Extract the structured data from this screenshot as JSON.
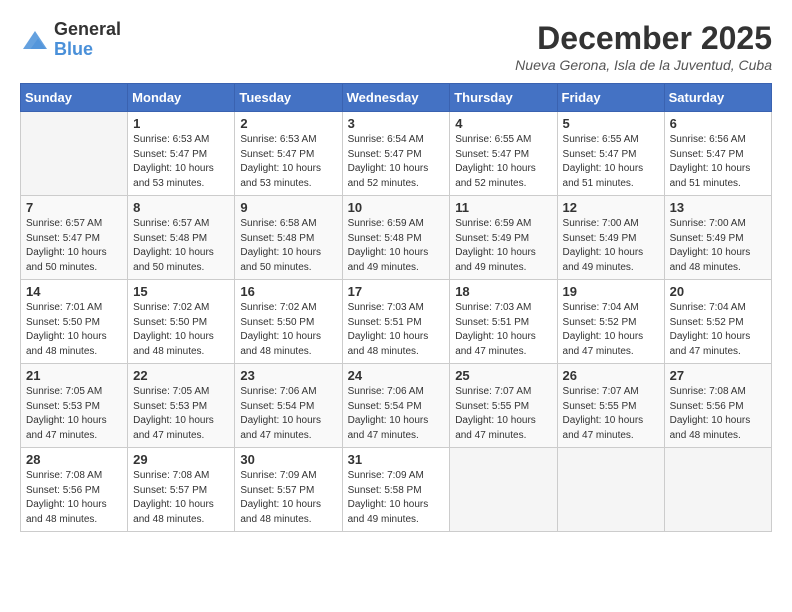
{
  "header": {
    "logo_general": "General",
    "logo_blue": "Blue",
    "title": "December 2025",
    "location": "Nueva Gerona, Isla de la Juventud, Cuba"
  },
  "weekdays": [
    "Sunday",
    "Monday",
    "Tuesday",
    "Wednesday",
    "Thursday",
    "Friday",
    "Saturday"
  ],
  "weeks": [
    [
      {
        "day": "",
        "info": ""
      },
      {
        "day": "1",
        "info": "Sunrise: 6:53 AM\nSunset: 5:47 PM\nDaylight: 10 hours\nand 53 minutes."
      },
      {
        "day": "2",
        "info": "Sunrise: 6:53 AM\nSunset: 5:47 PM\nDaylight: 10 hours\nand 53 minutes."
      },
      {
        "day": "3",
        "info": "Sunrise: 6:54 AM\nSunset: 5:47 PM\nDaylight: 10 hours\nand 52 minutes."
      },
      {
        "day": "4",
        "info": "Sunrise: 6:55 AM\nSunset: 5:47 PM\nDaylight: 10 hours\nand 52 minutes."
      },
      {
        "day": "5",
        "info": "Sunrise: 6:55 AM\nSunset: 5:47 PM\nDaylight: 10 hours\nand 51 minutes."
      },
      {
        "day": "6",
        "info": "Sunrise: 6:56 AM\nSunset: 5:47 PM\nDaylight: 10 hours\nand 51 minutes."
      }
    ],
    [
      {
        "day": "7",
        "info": "Sunrise: 6:57 AM\nSunset: 5:47 PM\nDaylight: 10 hours\nand 50 minutes."
      },
      {
        "day": "8",
        "info": "Sunrise: 6:57 AM\nSunset: 5:48 PM\nDaylight: 10 hours\nand 50 minutes."
      },
      {
        "day": "9",
        "info": "Sunrise: 6:58 AM\nSunset: 5:48 PM\nDaylight: 10 hours\nand 50 minutes."
      },
      {
        "day": "10",
        "info": "Sunrise: 6:59 AM\nSunset: 5:48 PM\nDaylight: 10 hours\nand 49 minutes."
      },
      {
        "day": "11",
        "info": "Sunrise: 6:59 AM\nSunset: 5:49 PM\nDaylight: 10 hours\nand 49 minutes."
      },
      {
        "day": "12",
        "info": "Sunrise: 7:00 AM\nSunset: 5:49 PM\nDaylight: 10 hours\nand 49 minutes."
      },
      {
        "day": "13",
        "info": "Sunrise: 7:00 AM\nSunset: 5:49 PM\nDaylight: 10 hours\nand 48 minutes."
      }
    ],
    [
      {
        "day": "14",
        "info": "Sunrise: 7:01 AM\nSunset: 5:50 PM\nDaylight: 10 hours\nand 48 minutes."
      },
      {
        "day": "15",
        "info": "Sunrise: 7:02 AM\nSunset: 5:50 PM\nDaylight: 10 hours\nand 48 minutes."
      },
      {
        "day": "16",
        "info": "Sunrise: 7:02 AM\nSunset: 5:50 PM\nDaylight: 10 hours\nand 48 minutes."
      },
      {
        "day": "17",
        "info": "Sunrise: 7:03 AM\nSunset: 5:51 PM\nDaylight: 10 hours\nand 48 minutes."
      },
      {
        "day": "18",
        "info": "Sunrise: 7:03 AM\nSunset: 5:51 PM\nDaylight: 10 hours\nand 47 minutes."
      },
      {
        "day": "19",
        "info": "Sunrise: 7:04 AM\nSunset: 5:52 PM\nDaylight: 10 hours\nand 47 minutes."
      },
      {
        "day": "20",
        "info": "Sunrise: 7:04 AM\nSunset: 5:52 PM\nDaylight: 10 hours\nand 47 minutes."
      }
    ],
    [
      {
        "day": "21",
        "info": "Sunrise: 7:05 AM\nSunset: 5:53 PM\nDaylight: 10 hours\nand 47 minutes."
      },
      {
        "day": "22",
        "info": "Sunrise: 7:05 AM\nSunset: 5:53 PM\nDaylight: 10 hours\nand 47 minutes."
      },
      {
        "day": "23",
        "info": "Sunrise: 7:06 AM\nSunset: 5:54 PM\nDaylight: 10 hours\nand 47 minutes."
      },
      {
        "day": "24",
        "info": "Sunrise: 7:06 AM\nSunset: 5:54 PM\nDaylight: 10 hours\nand 47 minutes."
      },
      {
        "day": "25",
        "info": "Sunrise: 7:07 AM\nSunset: 5:55 PM\nDaylight: 10 hours\nand 47 minutes."
      },
      {
        "day": "26",
        "info": "Sunrise: 7:07 AM\nSunset: 5:55 PM\nDaylight: 10 hours\nand 47 minutes."
      },
      {
        "day": "27",
        "info": "Sunrise: 7:08 AM\nSunset: 5:56 PM\nDaylight: 10 hours\nand 48 minutes."
      }
    ],
    [
      {
        "day": "28",
        "info": "Sunrise: 7:08 AM\nSunset: 5:56 PM\nDaylight: 10 hours\nand 48 minutes."
      },
      {
        "day": "29",
        "info": "Sunrise: 7:08 AM\nSunset: 5:57 PM\nDaylight: 10 hours\nand 48 minutes."
      },
      {
        "day": "30",
        "info": "Sunrise: 7:09 AM\nSunset: 5:57 PM\nDaylight: 10 hours\nand 48 minutes."
      },
      {
        "day": "31",
        "info": "Sunrise: 7:09 AM\nSunset: 5:58 PM\nDaylight: 10 hours\nand 49 minutes."
      },
      {
        "day": "",
        "info": ""
      },
      {
        "day": "",
        "info": ""
      },
      {
        "day": "",
        "info": ""
      }
    ]
  ]
}
